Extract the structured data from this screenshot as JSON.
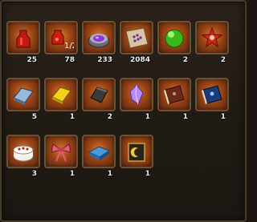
{
  "inventory": {
    "items": [
      {
        "name": "red-potion",
        "count": "25"
      },
      {
        "name": "half-red-potion",
        "count": "78",
        "overlay": "1/2"
      },
      {
        "name": "purple-gem-box",
        "count": "233"
      },
      {
        "name": "treasure-map",
        "count": "2084"
      },
      {
        "name": "green-orb",
        "count": "2"
      },
      {
        "name": "red-ornament",
        "count": "2"
      },
      {
        "name": "silver-bar",
        "count": "5"
      },
      {
        "name": "gold-bar",
        "count": "1"
      },
      {
        "name": "dark-ore",
        "count": "2"
      },
      {
        "name": "crystal-shard",
        "count": "1"
      },
      {
        "name": "brown-book",
        "count": "1"
      },
      {
        "name": "blue-book",
        "count": "1"
      },
      {
        "name": "cake",
        "count": "3"
      },
      {
        "name": "ribbon-bow",
        "count": "1"
      },
      {
        "name": "blue-cushion",
        "count": "1"
      },
      {
        "name": "moon-tome",
        "count": "1"
      }
    ]
  }
}
